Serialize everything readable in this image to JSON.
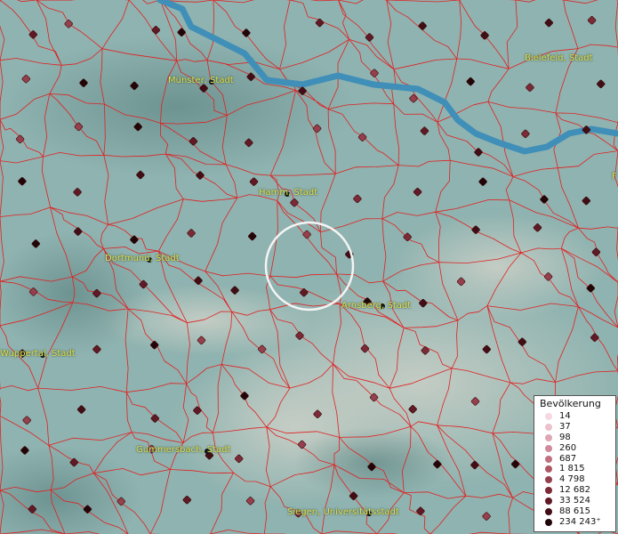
{
  "map": {
    "cities": [
      {
        "name": "Münster, Stadt"
      },
      {
        "name": "Bielefeld, Stadt"
      },
      {
        "name": "Hamm, Stadt"
      },
      {
        "name": "Dortmund, Stadt"
      },
      {
        "name": "Arnsberg, Stadt"
      },
      {
        "name": "Wuppertal, Stadt"
      },
      {
        "name": "Gummersbach, Stadt"
      },
      {
        "name": "Siegen, Universitätsstadt"
      }
    ],
    "edge_label_fragment": "F",
    "colors": {
      "boundary": "#e02020",
      "river": "#3f8fb8",
      "label": "#e8e34a",
      "terrain_base": "#8fb3b0",
      "dot": "#6e1a1a"
    }
  },
  "legend": {
    "title": "Bevölkerung",
    "entries": [
      {
        "label": "14",
        "color": "#f6d8e0"
      },
      {
        "label": "37",
        "color": "#ecc0cc"
      },
      {
        "label": "98",
        "color": "#dfa6b4"
      },
      {
        "label": "260",
        "color": "#d08a9c"
      },
      {
        "label": "687",
        "color": "#c07080"
      },
      {
        "label": "1 815",
        "color": "#ae5866"
      },
      {
        "label": "4 798",
        "color": "#96404e"
      },
      {
        "label": "12 682",
        "color": "#7c2a38"
      },
      {
        "label": "33 524",
        "color": "#601a26"
      },
      {
        "label": "88 615",
        "color": "#420e16"
      },
      {
        "label": "234 243⁺",
        "color": "#220508"
      }
    ]
  }
}
